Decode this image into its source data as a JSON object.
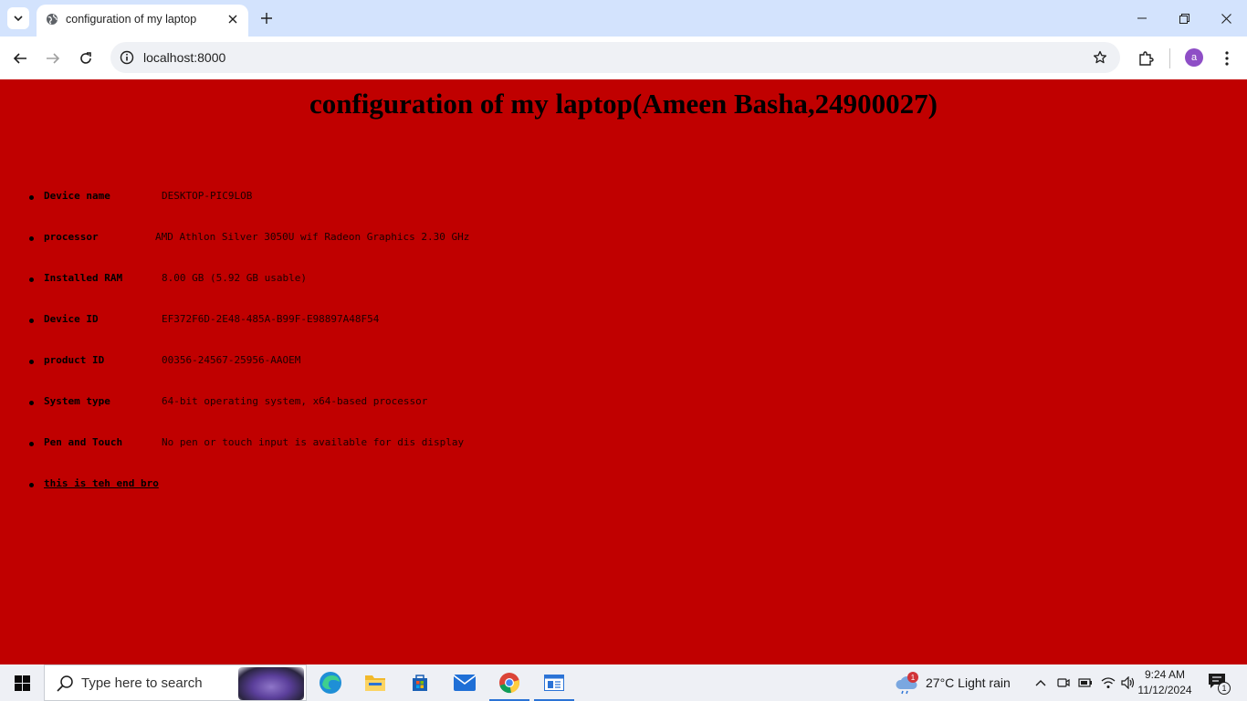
{
  "browser": {
    "tab_title": "configuration of my laptop",
    "url": "localhost:8000",
    "profile_initial": "a"
  },
  "page": {
    "heading": "configuration of my laptop(Ameen Basha,24900027)",
    "background_color": "#c00000",
    "items": [
      {
        "label": "Device name",
        "value": "DESKTOP-PIC9LOB"
      },
      {
        "label": "processor",
        "value": "AMD Athlon Silver 3050U wif Radeon Graphics 2.30 GHz"
      },
      {
        "label": "Installed RAM",
        "value": "8.00 GB (5.92 GB usable)"
      },
      {
        "label": "Device ID",
        "value": "EF372F6D-2E48-485A-B99F-E98897A48F54"
      },
      {
        "label": "product ID",
        "value": "00356-24567-25956-AAOEM"
      },
      {
        "label": "System type",
        "value": "64-bit operating system, x64-based processor"
      },
      {
        "label": "Pen and Touch",
        "value": "No pen or touch input is available for dis display"
      }
    ],
    "end_link": "this is teh end bro"
  },
  "taskbar": {
    "search_placeholder": "Type here to search",
    "weather_text": "27°C  Light rain",
    "weather_badge": "1",
    "time": "9:24 AM",
    "date": "11/12/2024",
    "notification_count": "1"
  }
}
